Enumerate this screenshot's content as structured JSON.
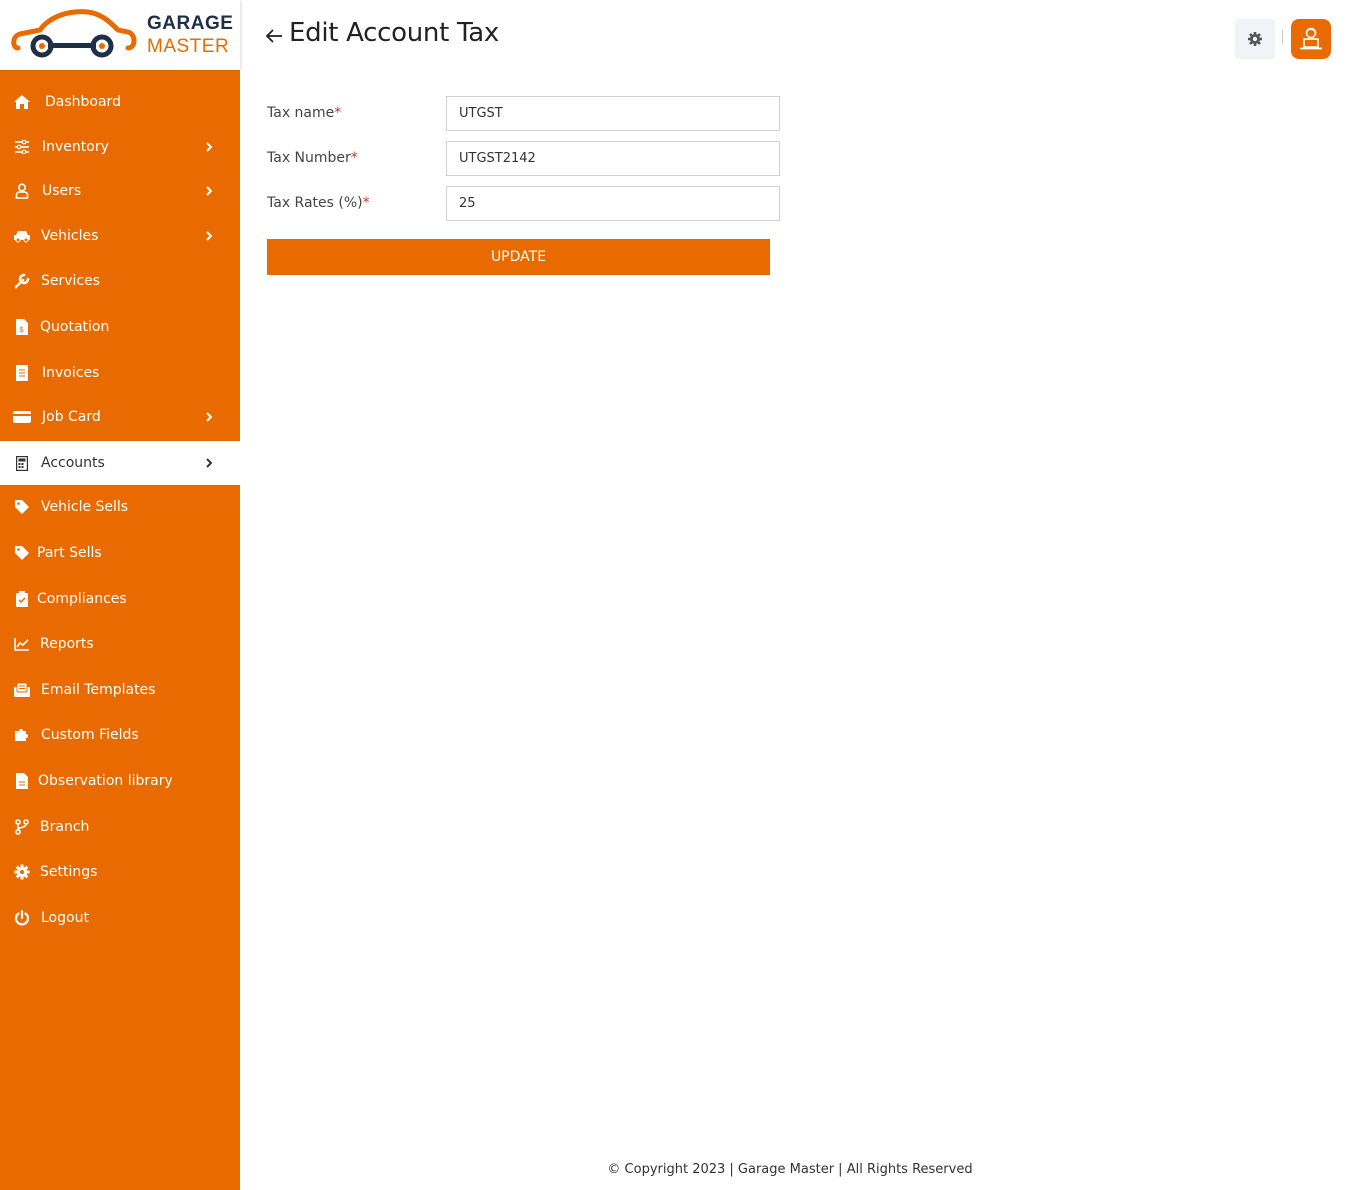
{
  "brand": {
    "line1": "GARAGE",
    "line2": "MASTER",
    "accent": "#e96b00"
  },
  "header": {
    "title": "Edit Account Tax",
    "back_icon": "arrow-left-icon",
    "settings_icon": "gear-icon",
    "user_icon": "user-avatar-icon"
  },
  "sidebar": {
    "items": [
      {
        "label": "Dashboard",
        "icon": "home-icon",
        "has_submenu": false,
        "active": false
      },
      {
        "label": "Inventory",
        "icon": "sliders-icon",
        "has_submenu": true,
        "active": false
      },
      {
        "label": "Users",
        "icon": "user-icon",
        "has_submenu": true,
        "active": false
      },
      {
        "label": "Vehicles",
        "icon": "car-icon",
        "has_submenu": true,
        "active": false
      },
      {
        "label": "Services",
        "icon": "wrench-icon",
        "has_submenu": false,
        "active": false
      },
      {
        "label": "Quotation",
        "icon": "file-invoice-dollar-icon",
        "has_submenu": false,
        "active": false
      },
      {
        "label": "Invoices",
        "icon": "receipt-icon",
        "has_submenu": false,
        "active": false
      },
      {
        "label": "Job Card",
        "icon": "credit-card-icon",
        "has_submenu": true,
        "active": false
      },
      {
        "label": "Accounts",
        "icon": "calculator-icon",
        "has_submenu": true,
        "active": true
      },
      {
        "label": "Vehicle Sells",
        "icon": "tag-icon",
        "has_submenu": false,
        "active": false
      },
      {
        "label": "Part Sells",
        "icon": "tag-icon",
        "has_submenu": false,
        "active": false
      },
      {
        "label": "Compliances",
        "icon": "clipboard-check-icon",
        "has_submenu": false,
        "active": false
      },
      {
        "label": "Reports",
        "icon": "chart-line-icon",
        "has_submenu": false,
        "active": false
      },
      {
        "label": "Email Templates",
        "icon": "envelope-open-icon",
        "has_submenu": false,
        "active": false
      },
      {
        "label": "Custom Fields",
        "icon": "puzzle-icon",
        "has_submenu": false,
        "active": false
      },
      {
        "label": "Observation library",
        "icon": "file-alt-icon",
        "has_submenu": false,
        "active": false
      },
      {
        "label": "Branch",
        "icon": "code-branch-icon",
        "has_submenu": false,
        "active": false
      },
      {
        "label": "Settings",
        "icon": "cog-icon",
        "has_submenu": false,
        "active": false
      },
      {
        "label": "Logout",
        "icon": "power-icon",
        "has_submenu": false,
        "active": false
      }
    ]
  },
  "form": {
    "fields": [
      {
        "label": "Tax name",
        "required_mark": "*",
        "value": "UTGST"
      },
      {
        "label": "Tax Number",
        "required_mark": "*",
        "value": "UTGST2142"
      },
      {
        "label": "Tax Rates (%)",
        "required_mark": "*",
        "value": "25"
      }
    ],
    "submit_label": "UPDATE"
  },
  "footer": {
    "text": "© Copyright 2023 | Garage Master | All Rights Reserved"
  }
}
